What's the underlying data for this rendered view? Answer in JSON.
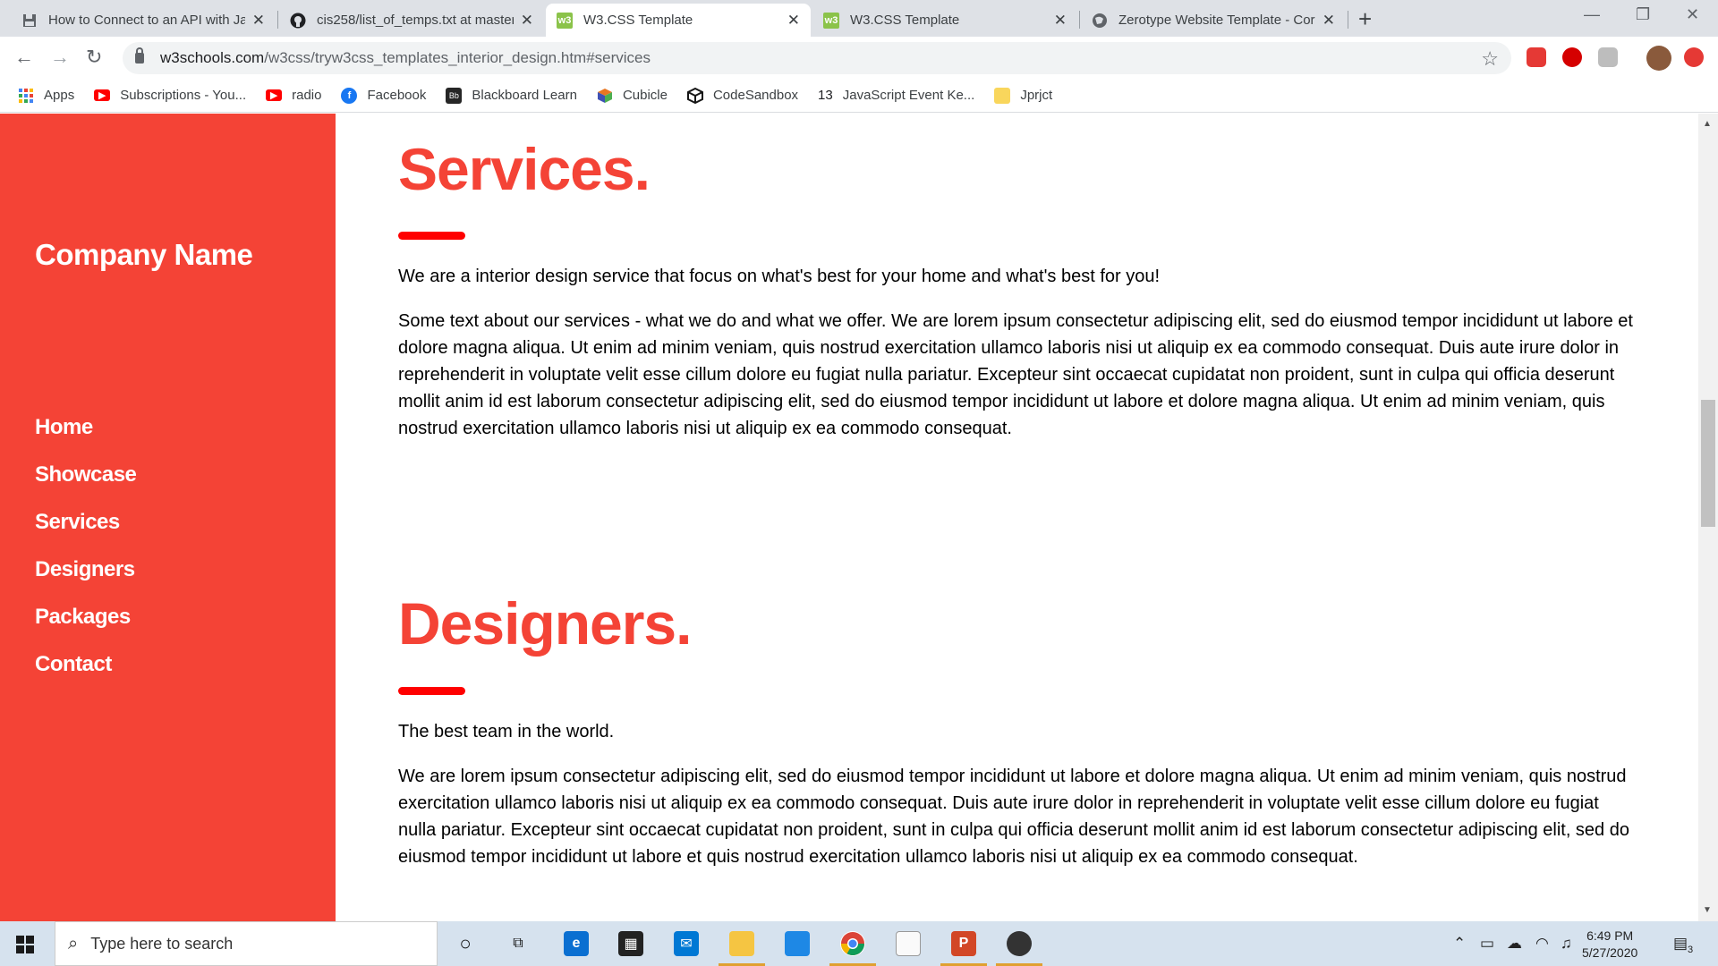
{
  "browser": {
    "tabs": [
      {
        "title": "How to Connect to an API with Ja",
        "favicon": "save-icon"
      },
      {
        "title": "cis258/list_of_temps.txt at master",
        "favicon": "github-icon"
      },
      {
        "title": "W3.CSS Template",
        "favicon": "w3-icon"
      },
      {
        "title": "W3.CSS Template",
        "favicon": "w3-icon"
      },
      {
        "title": "Zerotype Website Template - Cor",
        "favicon": "globe-icon"
      }
    ],
    "url_host": "w3schools.com",
    "url_path": "/w3css/tryw3css_templates_interior_design.htm#services",
    "bookmarks": [
      {
        "label": "Apps",
        "icon": "apps-grid-icon",
        "color": "#4285f4"
      },
      {
        "label": "Subscriptions - You...",
        "icon": "youtube-icon",
        "color": "#ff0000"
      },
      {
        "label": "radio",
        "icon": "youtube-icon",
        "color": "#ff0000"
      },
      {
        "label": "Facebook",
        "icon": "facebook-icon",
        "color": "#1877f2"
      },
      {
        "label": "Blackboard Learn",
        "icon": "blackboard-icon",
        "color": "#262626"
      },
      {
        "label": "Cubicle",
        "icon": "cube-icon",
        "color": "#e87722"
      },
      {
        "label": "CodeSandbox",
        "icon": "codesandbox-icon",
        "color": "#151515"
      },
      {
        "label": "JavaScript Event Ke...",
        "icon": "number-13-icon",
        "color": "#ffffff"
      },
      {
        "label": "Jprjct",
        "icon": "folder-icon",
        "color": "#f9d65c"
      }
    ],
    "bookmark_13": "13"
  },
  "page": {
    "company_name": "Company Name",
    "nav": [
      "Home",
      "Showcase",
      "Services",
      "Designers",
      "Packages",
      "Contact"
    ],
    "services": {
      "heading": "Services.",
      "lead": "We are a interior design service that focus on what's best for your home and what's best for you!",
      "body": "Some text about our services - what we do and what we offer. We are lorem ipsum consectetur adipiscing elit, sed do eiusmod tempor incididunt ut labore et dolore magna aliqua. Ut enim ad minim veniam, quis nostrud exercitation ullamco laboris nisi ut aliquip ex ea commodo consequat. Duis aute irure dolor in reprehenderit in voluptate velit esse cillum dolore eu fugiat nulla pariatur. Excepteur sint occaecat cupidatat non proident, sunt in culpa qui officia deserunt mollit anim id est laborum consectetur adipiscing elit, sed do eiusmod tempor incididunt ut labore et dolore magna aliqua. Ut enim ad minim veniam, quis nostrud exercitation ullamco laboris nisi ut aliquip ex ea commodo consequat."
    },
    "designers": {
      "heading": "Designers.",
      "lead": "The best team in the world.",
      "body": "We are lorem ipsum consectetur adipiscing elit, sed do eiusmod tempor incididunt ut labore et dolore magna aliqua. Ut enim ad minim veniam, quis nostrud exercitation ullamco laboris nisi ut aliquip ex ea commodo consequat. Duis aute irure dolor in reprehenderit in voluptate velit esse cillum dolore eu fugiat nulla pariatur. Excepteur sint occaecat cupidatat non proident, sunt in culpa qui officia deserunt mollit anim id est laborum consectetur adipiscing elit, sed do eiusmod tempor incididunt ut labore et quis nostrud exercitation ullamco laboris nisi ut aliquip ex ea commodo consequat."
    },
    "accent_color": "#f44336"
  },
  "taskbar": {
    "search_placeholder": "Type here to search",
    "time": "6:49 PM",
    "date": "5/27/2020",
    "notification_count": "3"
  }
}
